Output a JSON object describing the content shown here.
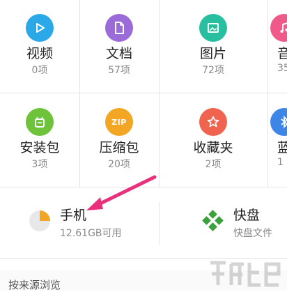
{
  "categories_row1": [
    {
      "name": "视频",
      "count": "0项",
      "color": "#2aa8e8",
      "icon": "play-icon"
    },
    {
      "name": "文档",
      "count": "57项",
      "color": "#9b6cd8",
      "icon": "document-icon"
    },
    {
      "name": "图片",
      "count": "72项",
      "color": "#27bfa0",
      "icon": "image-icon"
    },
    {
      "name": "音",
      "count": "35",
      "color": "#f05a8a",
      "icon": "music-icon"
    }
  ],
  "categories_row2": [
    {
      "name": "安装包",
      "count": "3项",
      "color": "#6ec33a",
      "icon": "package-icon"
    },
    {
      "name": "压缩包",
      "count": "20项",
      "color": "#f2a623",
      "icon": "zip-icon",
      "icon_text": "ZIP"
    },
    {
      "name": "收藏夹",
      "count": "2项",
      "color": "#f0634e",
      "icon": "star-icon"
    },
    {
      "name": "蓝",
      "count": "1",
      "color": "#3d86e8",
      "icon": "bluetooth-icon"
    }
  ],
  "storage": {
    "phone": {
      "title": "手机",
      "sub": "12.61GB可用",
      "used_fraction": 0.25
    },
    "kuaipan": {
      "title": "快盘",
      "sub": "快盘文件"
    }
  },
  "section_label": "按来源浏览",
  "annotation_color": "#e8317a"
}
